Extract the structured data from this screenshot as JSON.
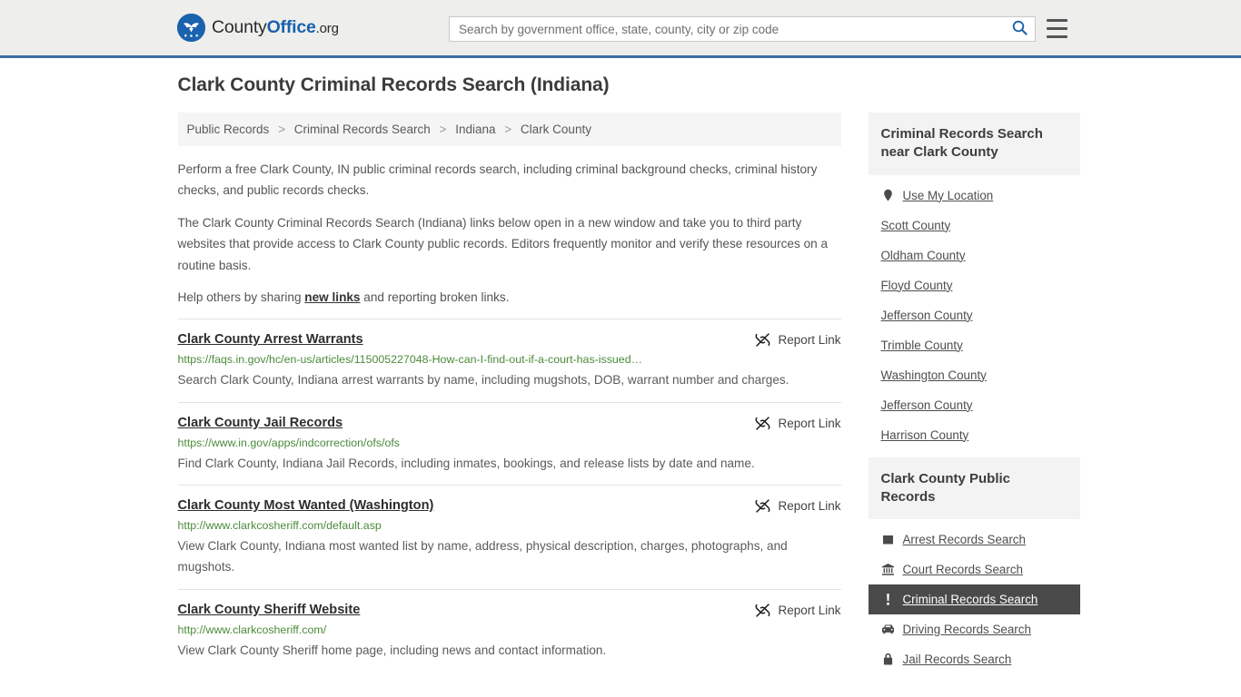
{
  "header": {
    "logo": {
      "part1": "County",
      "part2": "Office",
      "part3": ".org",
      "icon": "eagle-shield-logo-icon",
      "brand_color": "#1a62ad"
    },
    "search": {
      "placeholder": "Search by government office, state, county, city or zip code",
      "value": "",
      "search_icon": "search-icon",
      "menu_icon": "hamburger-menu-icon"
    }
  },
  "page": {
    "title": "Clark County Criminal Records Search (Indiana)"
  },
  "breadcrumb": {
    "items": [
      {
        "label": "Public Records"
      },
      {
        "label": "Criminal Records Search"
      },
      {
        "label": "Indiana"
      },
      {
        "label": "Clark County"
      }
    ],
    "separator": ">"
  },
  "intro": {
    "p1": "Perform a free Clark County, IN public criminal records search, including criminal background checks, criminal history checks, and public records checks.",
    "p2": "The Clark County Criminal Records Search (Indiana) links below open in a new window and take you to third party websites that provide access to Clark County public records. Editors frequently monitor and verify these resources on a routine basis.",
    "p3_before": "Help others by sharing ",
    "p3_link": "new links",
    "p3_after": " and reporting broken links."
  },
  "results": {
    "report_label": "Report Link",
    "report_icon": "broken-link-icon",
    "items": [
      {
        "title": "Clark County Arrest Warrants",
        "url": "https://faqs.in.gov/hc/en-us/articles/115005227048-How-can-I-find-out-if-a-court-has-issued…",
        "description": "Search Clark County, Indiana arrest warrants by name, including mugshots, DOB, warrant number and charges."
      },
      {
        "title": "Clark County Jail Records",
        "url": "https://www.in.gov/apps/indcorrection/ofs/ofs",
        "description": "Find Clark County, Indiana Jail Records, including inmates, bookings, and release lists by date and name."
      },
      {
        "title": "Clark County Most Wanted (Washington)",
        "url": "http://www.clarkcosheriff.com/default.asp",
        "description": "View Clark County, Indiana most wanted list by name, address, physical description, charges, photographs, and mugshots."
      },
      {
        "title": "Clark County Sheriff Website",
        "url": "http://www.clarkcosheriff.com/",
        "description": "View Clark County Sheriff home page, including news and contact information."
      }
    ]
  },
  "sidebar": {
    "nearby": {
      "heading": "Criminal Records Search near Clark County",
      "items": [
        {
          "label": "Use My Location",
          "icon": "map-pin-icon"
        },
        {
          "label": "Scott County",
          "icon": ""
        },
        {
          "label": "Oldham County",
          "icon": ""
        },
        {
          "label": "Floyd County",
          "icon": ""
        },
        {
          "label": "Jefferson County",
          "icon": ""
        },
        {
          "label": "Trimble County",
          "icon": ""
        },
        {
          "label": "Washington County",
          "icon": ""
        },
        {
          "label": "Jefferson County",
          "icon": ""
        },
        {
          "label": "Harrison County",
          "icon": ""
        }
      ]
    },
    "public_records": {
      "heading": "Clark County Public Records",
      "items": [
        {
          "label": "Arrest Records Search",
          "icon": "fingerprint-square-icon",
          "active": false
        },
        {
          "label": "Court Records Search",
          "icon": "courthouse-icon",
          "active": false
        },
        {
          "label": "Criminal Records Search",
          "icon": "exclamation-icon",
          "active": true
        },
        {
          "label": "Driving Records Search",
          "icon": "car-icon",
          "active": false
        },
        {
          "label": "Jail Records Search",
          "icon": "lock-icon",
          "active": false
        }
      ]
    }
  }
}
